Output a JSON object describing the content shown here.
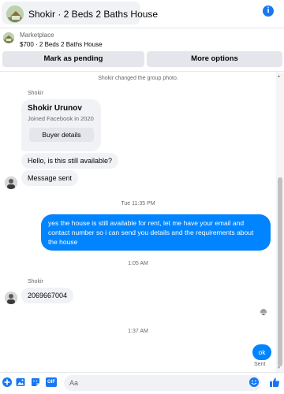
{
  "header": {
    "title": "Shokir · 2 Beds 2 Baths House",
    "info_icon": "info-icon",
    "info_glyph": "i"
  },
  "listing": {
    "label": "Marketplace",
    "detail": "$700 · 2 Beds 2 Baths House"
  },
  "actions": {
    "pending_label": "Mark as pending",
    "more_label": "More options"
  },
  "chat": {
    "system_notice": "Shokir changed the group photo.",
    "sender_name_1": "Shokir",
    "profile_card": {
      "name": "Shokir Urunov",
      "joined": "Joined Facebook in 2020",
      "button_label": "Buyer details"
    },
    "msg_question": "Hello, is this still available?",
    "msg_sent_notice": "Message sent",
    "timestamp_1": "Tue 11:35 PM",
    "reply_out": "yes the house is still available for rent, let me have your email  and contact number so i can send you details and the requirements about the house",
    "timestamp_2": "1:05 AM",
    "sender_name_2": "Shokir",
    "msg_phone": "2069667004",
    "timestamp_3": "1:37 AM",
    "reply_ok": "ok",
    "status": "Sent"
  },
  "composer": {
    "placeholder": "Aa",
    "icons": [
      "add-icon",
      "photo-icon",
      "sticker-icon",
      "gif-icon",
      "emoji-icon",
      "like-icon"
    ],
    "gif_label": "GIF"
  },
  "colors": {
    "accent": "#1877f2",
    "outgoing_bubble": "#0084ff",
    "incoming_bubble": "#f0f2f5"
  }
}
